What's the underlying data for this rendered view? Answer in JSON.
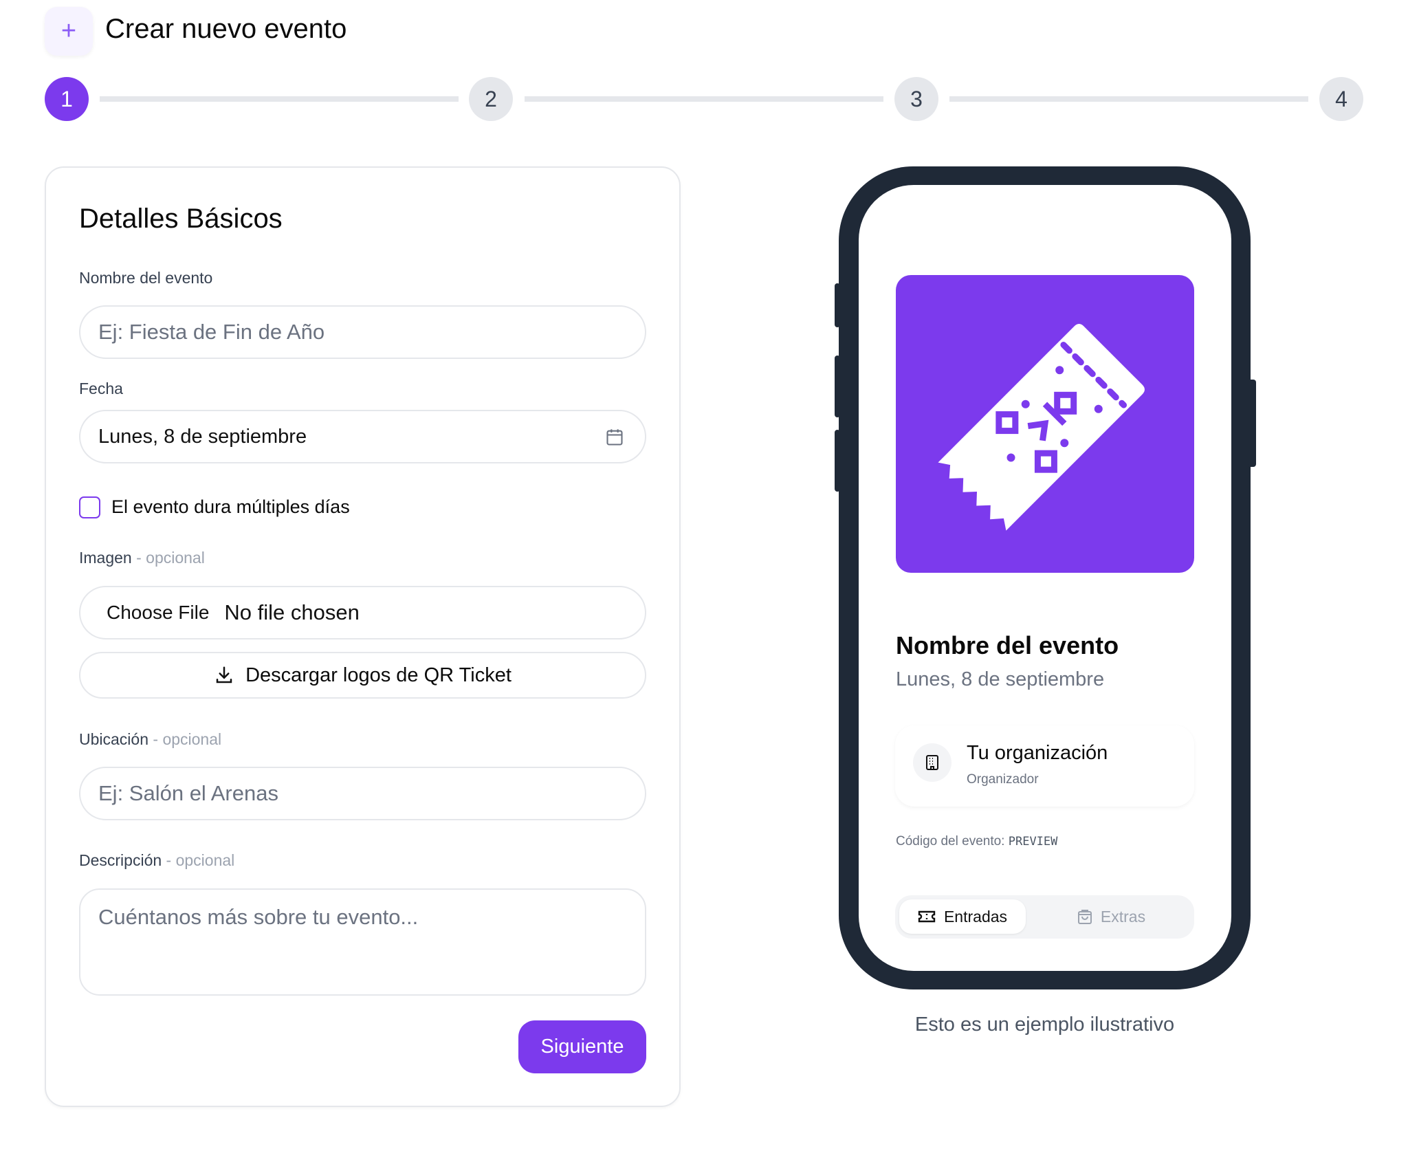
{
  "header": {
    "title": "Crear nuevo evento",
    "icon": "plus-icon"
  },
  "stepper": {
    "steps": [
      "1",
      "2",
      "3",
      "4"
    ],
    "active": 1,
    "accent": "#7c3aed"
  },
  "form": {
    "heading": "Detalles Básicos",
    "name_label": "Nombre del evento",
    "name_placeholder": "Ej: Fiesta de Fin de Año",
    "date_label": "Fecha",
    "date_value": "Lunes, 8 de septiembre",
    "multi_day_label": "El evento dura múltiples días",
    "multi_day_checked": false,
    "image_label": "Imagen",
    "optional": "- opcional",
    "file_button": "Choose File",
    "file_status": "No file chosen",
    "download_label": "Descargar logos de QR Ticket",
    "location_label": "Ubicación",
    "location_placeholder": "Ej: Salón el Arenas",
    "description_label": "Descripción",
    "description_placeholder": "Cuéntanos más sobre tu evento...",
    "next_label": "Siguiente"
  },
  "preview": {
    "event_name": "Nombre del evento",
    "event_date": "Lunes, 8 de septiembre",
    "org_name": "Tu organización",
    "org_role": "Organizador",
    "code_label": "Código del evento:",
    "code_value": "PREVIEW",
    "tabs": [
      "Entradas",
      "Extras"
    ],
    "caption": "Esto es un ejemplo ilustrativo"
  }
}
